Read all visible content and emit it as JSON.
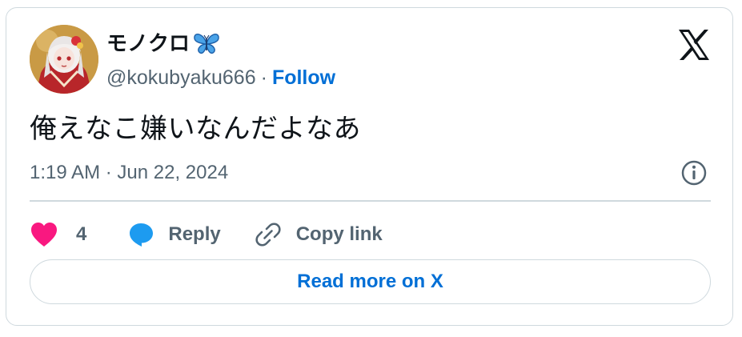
{
  "tweet": {
    "author": {
      "display_name": "モノクロ",
      "name_emoji_icon": "butterfly-icon",
      "handle": "@kokubyaku666",
      "separator": "·",
      "follow_label": "Follow",
      "avatar_icon": "avatar-image"
    },
    "text": "俺えなこ嫌いなんだよなあ",
    "timestamp": "1:19 AM · Jun 22, 2024",
    "actions": {
      "like_count": "4",
      "reply_label": "Reply",
      "copy_link_label": "Copy link"
    },
    "read_more_label": "Read more on X"
  },
  "colors": {
    "like": "#f91880",
    "reply": "#1d9bf0",
    "link": "#006fd6",
    "secondary_text": "#536471",
    "border": "#cfd9de"
  }
}
